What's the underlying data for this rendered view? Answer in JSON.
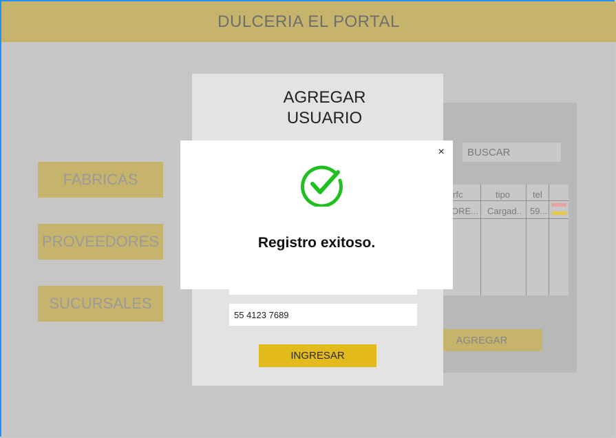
{
  "app": {
    "title": "DULCERIA EL PORTAL"
  },
  "sidebar": {
    "items": [
      {
        "label": "FABRICAS"
      },
      {
        "label": "PROVEEDORES"
      },
      {
        "label": "SUCURSALES"
      }
    ]
  },
  "table": {
    "search_placeholder": "BUSCAR",
    "columns": [
      "rfc",
      "tipo",
      "tel"
    ],
    "rows": [
      {
        "rfc": "ORE...",
        "tipo": "Cargad..",
        "tel": "59..."
      }
    ],
    "edit_color": "#e8a0a0",
    "delete_color": "#e8c94a",
    "add_button": "AGREGAR"
  },
  "add_user": {
    "title_line1": "AGREGAR",
    "title_line2": "USUARIO",
    "phone_value": "55 4123 7689",
    "submit_label": "INGRESAR"
  },
  "success_modal": {
    "message": "Registro exitoso.",
    "close_icon": "close-icon",
    "status_icon": "check-circle-icon",
    "accent": "#1fc01f"
  }
}
